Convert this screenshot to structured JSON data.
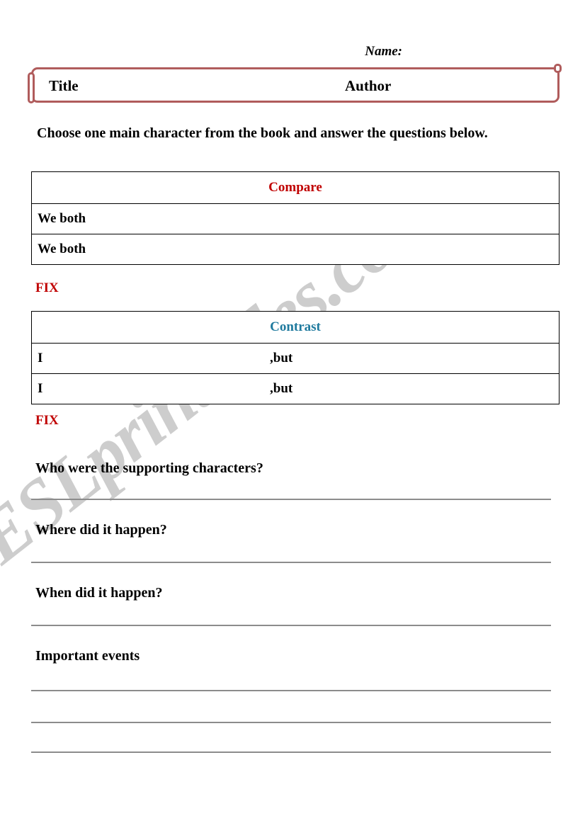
{
  "page": {
    "name_label": "Name:",
    "background_color": "#ffffff"
  },
  "title_box": {
    "title_label": "Title",
    "author_label": "Author",
    "border_color": "#b05c5c"
  },
  "instructions": {
    "text": "Choose one main character from the book and answer the questions below."
  },
  "compare_table": {
    "header": "Compare",
    "header_color": "#c00000",
    "rows": [
      {
        "left": "We both",
        "mid": ""
      },
      {
        "left": "We both",
        "mid": ""
      }
    ]
  },
  "contrast_table": {
    "header": "Contrast",
    "header_color": "#1f7a9e",
    "rows": [
      {
        "left": "I",
        "mid": ",but"
      },
      {
        "left": "I",
        "mid": ",but"
      }
    ]
  },
  "fix_markers": {
    "first": "FIX",
    "second": "FIX",
    "color": "#c00000"
  },
  "questions": [
    {
      "text": "Who were the supporting characters?"
    },
    {
      "text": "Where did it happen?"
    },
    {
      "text": "When did it happen?"
    },
    {
      "text": "Important events"
    }
  ],
  "watermark": {
    "text": "ESLprintables.com",
    "color": "#c9c9c9"
  }
}
